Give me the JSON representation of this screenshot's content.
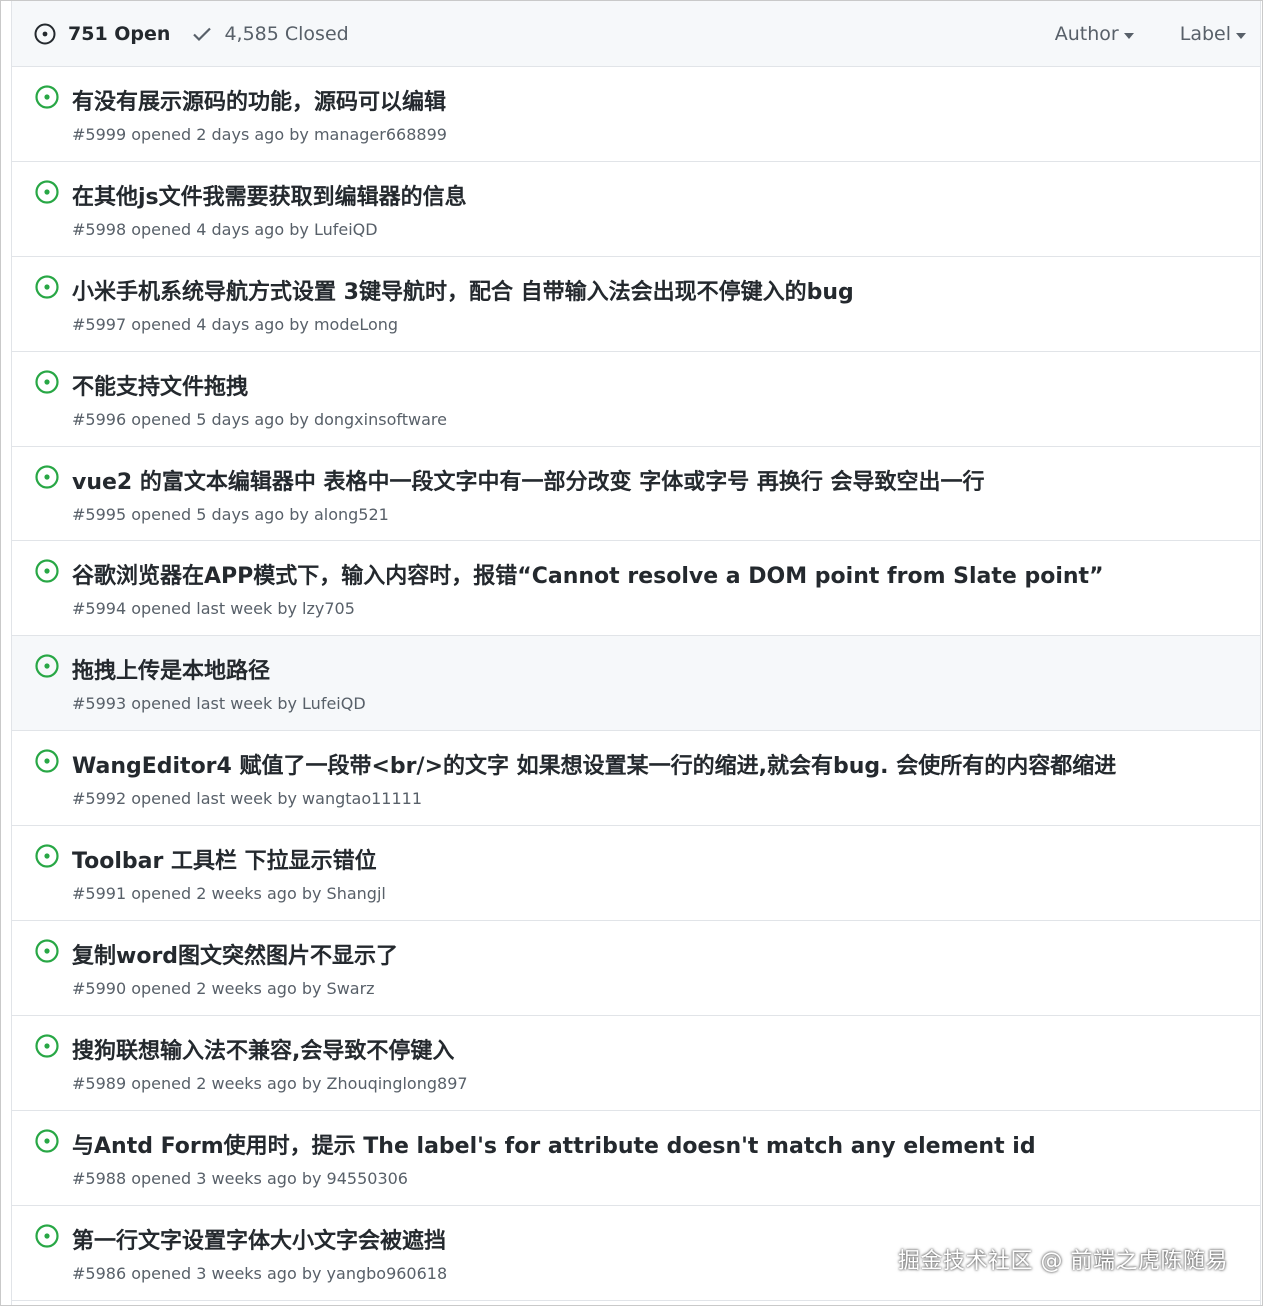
{
  "header": {
    "open_label": "751 Open",
    "closed_label": "4,585 Closed",
    "filters": {
      "author": "Author",
      "label": "Label"
    }
  },
  "colors": {
    "open_green": "#28a745",
    "muted": "#586069",
    "text": "#24292e"
  },
  "issues": [
    {
      "title": "有没有展示源码的功能，源码可以编辑",
      "number": "#5999",
      "age": "2 days ago",
      "author": "manager668899"
    },
    {
      "title": "在其他js文件我需要获取到编辑器的信息",
      "number": "#5998",
      "age": "4 days ago",
      "author": "LufeiQD"
    },
    {
      "title": "小米手机系统导航方式设置 3键导航时，配合 自带输入法会出现不停键入的bug",
      "number": "#5997",
      "age": "4 days ago",
      "author": "modeLong"
    },
    {
      "title": "不能支持文件拖拽",
      "number": "#5996",
      "age": "5 days ago",
      "author": "dongxinsoftware"
    },
    {
      "title": "vue2 的富文本编辑器中 表格中一段文字中有一部分改变 字体或字号 再换行 会导致空出一行",
      "number": "#5995",
      "age": "5 days ago",
      "author": "along521"
    },
    {
      "title": "谷歌浏览器在APP模式下，输入内容时，报错“Cannot resolve a DOM point from Slate point”",
      "number": "#5994",
      "age": "last week",
      "author": "lzy705"
    },
    {
      "title": "拖拽上传是本地路径",
      "number": "#5993",
      "age": "last week",
      "author": "LufeiQD",
      "hover": true
    },
    {
      "title": "WangEditor4 赋值了一段带<br/>的文字 如果想设置某一行的缩进,就会有bug. 会使所有的内容都缩进",
      "number": "#5992",
      "age": "last week",
      "author": "wangtao11111"
    },
    {
      "title": "Toolbar 工具栏 下拉显示错位",
      "number": "#5991",
      "age": "2 weeks ago",
      "author": "Shangjl"
    },
    {
      "title": "复制word图文突然图片不显示了",
      "number": "#5990",
      "age": "2 weeks ago",
      "author": "Swarz"
    },
    {
      "title": "搜狗联想输入法不兼容,会导致不停键入",
      "number": "#5989",
      "age": "2 weeks ago",
      "author": "Zhouqinglong897"
    },
    {
      "title": "与Antd Form使用时，提示 The label's for attribute doesn't match any element id",
      "number": "#5988",
      "age": "3 weeks ago",
      "author": "94550306"
    },
    {
      "title": "第一行文字设置字体大小文字会被遮挡",
      "number": "#5986",
      "age": "3 weeks ago",
      "author": "yangbo960618"
    }
  ],
  "meta_words": {
    "opened": "opened",
    "by": "by"
  },
  "watermark": "掘金技术社区 @ 前端之虎陈随易"
}
